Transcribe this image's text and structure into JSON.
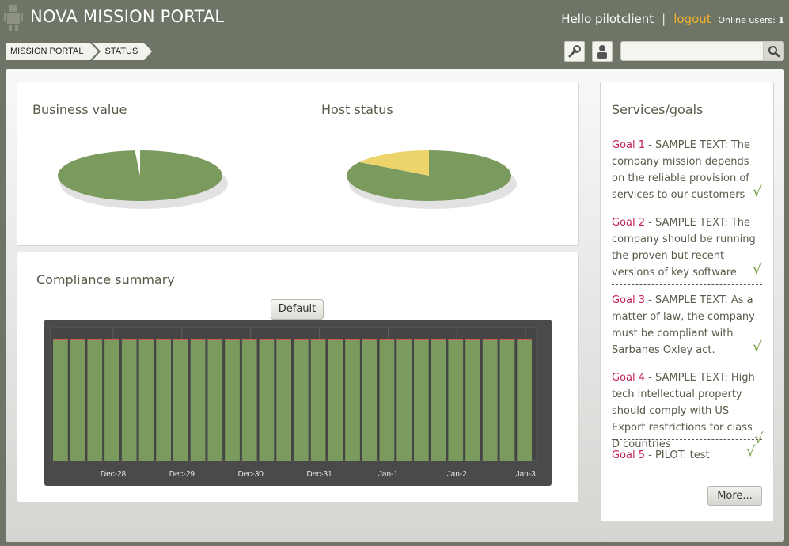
{
  "header": {
    "title": "NOVA MISSION PORTAL",
    "greeting": "Hello pilotclient",
    "separator": "|",
    "logout_label": "logout",
    "online_label": "Online users:",
    "online_count": "1",
    "logo_icon": "robot-icon"
  },
  "breadcrumb": [
    "MISSION PORTAL",
    "STATUS"
  ],
  "toolbar": {
    "settings_icon": "wrench-icon",
    "user_icon": "user-icon",
    "search_placeholder": "",
    "search_value": "",
    "search_icon": "magnifier-icon"
  },
  "status_panel": {
    "business_value_title": "Business value",
    "host_status_title": "Host status"
  },
  "compliance": {
    "title": "Compliance summary",
    "tab_label": "Default"
  },
  "services": {
    "title": "Services/goals",
    "goals": [
      {
        "name": "Goal 1",
        "text": " - SAMPLE TEXT: The company mission depends on the reliable provision of services to our customers",
        "check": "√"
      },
      {
        "name": "Goal 2",
        "text": " - SAMPLE TEXT: The company should be running the proven but recent versions of key software",
        "check": "√"
      },
      {
        "name": "Goal 3",
        "text": " - SAMPLE TEXT: As a matter of law, the company must be compliant with Sarbanes Oxley act.",
        "check": "√"
      },
      {
        "name": "Goal 4",
        "text": " - SAMPLE TEXT: High tech intellectual property should comply with US Export restrictions for class D countries",
        "check": "√"
      },
      {
        "name": "Goal 5",
        "text": " - PILOT: test",
        "check": "√"
      }
    ],
    "more_label": "More..."
  },
  "colors": {
    "ok_green": "#7a9a5e",
    "warn_yellow": "#ecd46a",
    "goal_name": "#c21f5a",
    "logout": "#f2b42a"
  },
  "chart_data": [
    {
      "type": "pie",
      "title": "Business value",
      "series": [
        {
          "label": "",
          "value": 99,
          "color": "#7a9a5e"
        },
        {
          "label": "",
          "value": 1,
          "color": "#ffffff"
        }
      ]
    },
    {
      "type": "pie",
      "title": "Host status",
      "series": [
        {
          "label": "",
          "value": 84,
          "color": "#7a9a5e"
        },
        {
          "label": "",
          "value": 16,
          "color": "#ecd46a"
        }
      ]
    },
    {
      "type": "bar",
      "title": "Compliance summary",
      "x_tick_labels": [
        "Dec-28",
        "Dec-29",
        "Dec-30",
        "Dec-31",
        "Jan-1",
        "Jan-2",
        "Jan-3"
      ],
      "bar_count": 28,
      "values": [
        100,
        100,
        100,
        100,
        100,
        100,
        100,
        100,
        100,
        100,
        100,
        100,
        100,
        100,
        100,
        100,
        100,
        100,
        100,
        100,
        100,
        100,
        100,
        100,
        100,
        100,
        100,
        100
      ],
      "ylim": [
        0,
        100
      ],
      "bar_color": "#7a9a5e",
      "top_line_color": "#d05a5a"
    }
  ]
}
